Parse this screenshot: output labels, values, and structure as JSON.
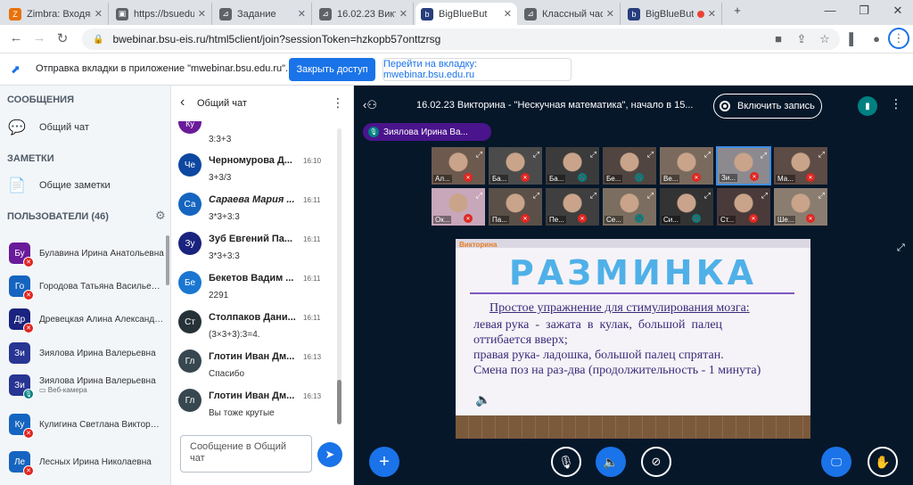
{
  "browser": {
    "tabs": [
      {
        "title": "Zimbra: Входящ",
        "fav_color": "#e8710a",
        "fav_icon": "Z"
      },
      {
        "title": "https://bsuedu",
        "fav_color": "#5f6368",
        "fav_icon": "▣"
      },
      {
        "title": "Задание",
        "fav_color": "#5f6368",
        "fav_icon": "⊿"
      },
      {
        "title": "16.02.23 Виктор",
        "fav_color": "#5f6368",
        "fav_icon": "⊿"
      },
      {
        "title": "BigBlueBut",
        "fav_color": "#273e7d",
        "fav_icon": "b",
        "active": true
      },
      {
        "title": "Классный час",
        "fav_color": "#5f6368",
        "fav_icon": "⊿"
      },
      {
        "title": "BigBlueBut",
        "fav_color": "#273e7d",
        "fav_icon": "b"
      }
    ],
    "new_tab": "+",
    "url": "bwebinar.bsu-eis.ru/html5client/join?sessionToken=hzkopb57onttzrsg",
    "infobar": {
      "message": "Отправка вкладки в приложение \"mwebinar.bsu.edu.ru\"...",
      "primary_button": "Закрыть доступ",
      "secondary_button": "Перейти на вкладку: mwebinar.bsu.edu.ru"
    }
  },
  "sidebar": {
    "messages_title": "СООБЩЕНИЯ",
    "public_chat": "Общий чат",
    "notes_title": "ЗАМЕТКИ",
    "shared_notes": "Общие заметки",
    "users_title": "ПОЛЬЗОВАТЕЛИ (46)",
    "users": [
      {
        "initials": "Бу",
        "name": "Булавина Ирина Анатольевна",
        "color": "#6a1b9a",
        "mic": "muted"
      },
      {
        "initials": "Го",
        "name": "Городова Татьяна Васильевна",
        "color": "#1565c0",
        "mic": "muted"
      },
      {
        "initials": "Др",
        "name": "Древецкая Алина Александро...",
        "color": "#1a237e",
        "mic": "muted"
      },
      {
        "initials": "Зи",
        "name": "Зиялова Ирина Валерьевна",
        "color": "#283593",
        "mic": ""
      },
      {
        "initials": "Зи",
        "name": "Зиялова Ирина Валерьевна",
        "sub": "▭ Веб-камера",
        "color": "#283593",
        "mic": "on"
      },
      {
        "initials": "Ку",
        "name": "Кулигина Светлана Викторовна",
        "color": "#1565c0",
        "mic": "muted"
      },
      {
        "initials": "Ле",
        "name": "Лесных Ирина Николаевна",
        "color": "#1565c0",
        "mic": "muted"
      }
    ]
  },
  "chat": {
    "back": "‹",
    "title": "Общий чат",
    "menu": "⋮",
    "top_fragment": "3:3+3",
    "messages": [
      {
        "initials": "Че",
        "name": "Черномурова Д...",
        "time": "16:10",
        "text": "3+3/3",
        "color": "#0d47a1"
      },
      {
        "initials": "Са",
        "name": "Сараева Мария ...",
        "time": "16:11",
        "text": "3*3+3:3",
        "color": "#1565c0",
        "italic": true
      },
      {
        "initials": "Зу",
        "name": "Зуб Евгений Па...",
        "time": "16:11",
        "text": "3*3+3:3",
        "color": "#1a237e"
      },
      {
        "initials": "Бе",
        "name": "Бекетов Вадим ...",
        "time": "16:11",
        "text": "2291",
        "color": "#1976d2"
      },
      {
        "initials": "Ст",
        "name": "Столпаков Дани...",
        "time": "16:11",
        "text": "(3×3+3):3=4.",
        "color": "#263238"
      },
      {
        "initials": "Гл",
        "name": "Глотин Иван Дм...",
        "time": "16:13",
        "text": "Спасибо",
        "color": "#37474f"
      },
      {
        "initials": "Гл",
        "name": "Глотин Иван Дм...",
        "time": "16:13",
        "text": "Вы тоже крутые",
        "color": "#37474f"
      }
    ],
    "input_placeholder": "Сообщение в Общий чат"
  },
  "meeting": {
    "title": "16.02.23 Викторина - \"Нескучная математика\", начало в 15...",
    "record_label": "Включить запись",
    "presenter_badge": "Зиялова Ирина Ва...",
    "videos": [
      {
        "label": "Ал...",
        "mic": "muted",
        "color": "#6d5a4e"
      },
      {
        "label": "Ба...",
        "mic": "muted",
        "color": "#4b4b4b"
      },
      {
        "label": "Ба...",
        "mic": "on",
        "color": "#3b3b3b"
      },
      {
        "label": "Бе...",
        "mic": "on",
        "color": "#504540"
      },
      {
        "label": "Ве...",
        "mic": "muted",
        "color": "#7a6a5d"
      },
      {
        "label": "Зи...",
        "mic": "muted",
        "color": "#8d8a8f",
        "selected": true
      },
      {
        "label": "Ма...",
        "mic": "muted",
        "color": "#5d4b45"
      },
      {
        "label": "Ок...",
        "mic": "muted",
        "color": "#c7a7b9"
      },
      {
        "label": "Па...",
        "mic": "muted",
        "color": "#5a5048"
      },
      {
        "label": "Пе...",
        "mic": "muted",
        "color": "#3f3f3f"
      },
      {
        "label": "Се...",
        "mic": "on",
        "color": "#7b6e60"
      },
      {
        "label": "Си...",
        "mic": "on",
        "color": "#333333"
      },
      {
        "label": "Ст...",
        "mic": "muted",
        "color": "#4a3a3a"
      },
      {
        "label": "Ше...",
        "mic": "muted",
        "color": "#8a7d70"
      }
    ],
    "slide": {
      "tag": "Викторина",
      "heading": "РАЗМИНКА",
      "subtitle": "Простое упражнение для стимулирования мозга:",
      "lines": [
        "левая рука  -  зажата  в  кулак,  большой  палец",
        "оттибается вверх;",
        "правая рука- ладошка, большой палец спрятан.",
        "Смена поз на раз-два (продолжительность - 1 минута)"
      ]
    }
  }
}
